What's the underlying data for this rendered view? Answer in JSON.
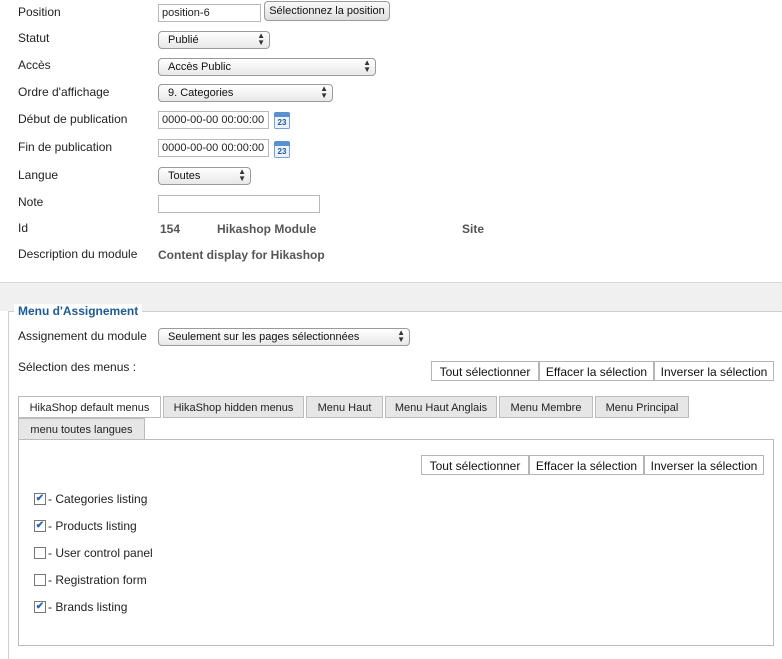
{
  "fields": {
    "position": {
      "label": "Position",
      "value": "position-6",
      "button": "Sélectionnez la position"
    },
    "statut": {
      "label": "Statut",
      "value": "Publié"
    },
    "acces": {
      "label": "Accès",
      "value": "Accès Public"
    },
    "ordre": {
      "label": "Ordre d'affichage",
      "value": "9. Categories"
    },
    "debut": {
      "label": "Début de publication",
      "value": "0000-00-00 00:00:00",
      "calendar_day": "23"
    },
    "fin": {
      "label": "Fin de publication",
      "value": "0000-00-00 00:00:00",
      "calendar_day": "23"
    },
    "langue": {
      "label": "Langue",
      "value": "Toutes"
    },
    "note": {
      "label": "Note",
      "value": ""
    },
    "id": {
      "label": "Id",
      "value": "154",
      "type": "Hikashop Module",
      "client": "Site"
    },
    "description": {
      "label": "Description du module",
      "value": "Content display for Hikashop"
    }
  },
  "assignment": {
    "legend": "Menu d'Assignement",
    "module_label": "Assignement du module",
    "module_value": "Seulement sur les pages sélectionnées",
    "menus_label": "Sélection des menus :",
    "select_all": "Tout sélectionner",
    "clear": "Effacer la sélection",
    "invert": "Inverser la sélection",
    "tabs": [
      "HikaShop default menus",
      "HikaShop hidden menus",
      "Menu Haut",
      "Menu Haut Anglais",
      "Menu Membre",
      "Menu Principal",
      "menu toutes langues"
    ],
    "panel": {
      "select_all": "Tout sélectionner",
      "clear": "Effacer la sélection",
      "invert": "Inverser la sélection",
      "items": [
        {
          "label": "- Categories listing",
          "checked": true
        },
        {
          "label": "- Products listing",
          "checked": true
        },
        {
          "label": "- User control panel",
          "checked": false
        },
        {
          "label": "- Registration form",
          "checked": false
        },
        {
          "label": "- Brands listing",
          "checked": true
        }
      ]
    }
  },
  "colors": {
    "legend": "#1f5a96",
    "calendar": "#5a8fd0",
    "check": "#2a63b8"
  }
}
